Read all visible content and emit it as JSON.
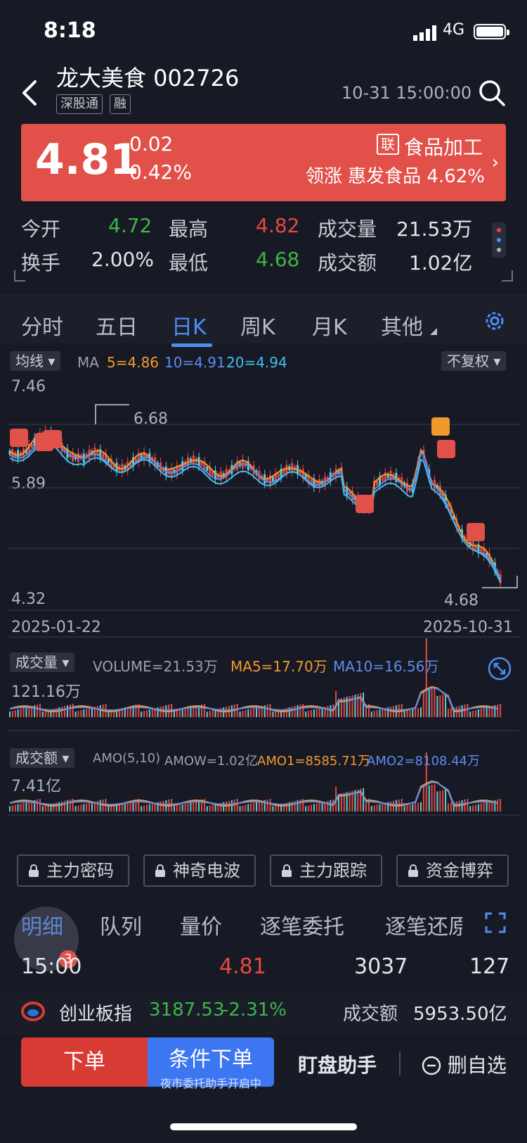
{
  "status_bar": {
    "time": "8:18",
    "network": "4G"
  },
  "header": {
    "stock_name": "龙大美食 002726",
    "tags": [
      "深股通",
      "融"
    ],
    "datetime": "10-31 15:00:00"
  },
  "quote": {
    "price": "4.81",
    "change": "0.02",
    "change_pct": "0.42%",
    "sector_tag": "联",
    "sector": "食品加工",
    "leader": "领涨 惠发食品 4.62%"
  },
  "stats": {
    "open_label": "今开",
    "open": "4.72",
    "high_label": "最高",
    "high": "4.82",
    "vol_label": "成交量",
    "vol": "21.53万",
    "turnover_label": "换手",
    "turnover": "2.00%",
    "low_label": "最低",
    "low": "4.68",
    "amount_label": "成交额",
    "amount": "1.02亿"
  },
  "tabs": [
    "分时",
    "五日",
    "日K",
    "周K",
    "月K",
    "其他"
  ],
  "kline": {
    "ma_dropdown": "均线",
    "ma_label": "MA",
    "ma5": "5=4.86",
    "ma10": "10=4.91",
    "ma20": "20=4.94",
    "adjust_dropdown": "不复权",
    "y_top": "7.46",
    "y_mid": "5.89",
    "y_bottom": "4.32",
    "max_marker": "6.68",
    "min_marker": "4.68",
    "date_start": "2025-01-22",
    "date_end": "2025-10-31",
    "markers": [
      "建",
      "买",
      "买",
      "T",
      "买",
      "买",
      "买"
    ]
  },
  "volume_panel": {
    "dropdown": "成交量",
    "volume": "VOLUME=21.53万",
    "ma5": "MA5=17.70万",
    "ma10": "MA10=16.56万",
    "max": "121.16万"
  },
  "amount_panel": {
    "dropdown": "成交额",
    "amo": "AMO(5,10)",
    "amow": "AMOW=1.02亿",
    "amo1": "AMO1=8585.71万",
    "amo2": "AMO2=8108.44万",
    "max": "7.41亿"
  },
  "premium_buttons": [
    "主力密码",
    "神奇电波",
    "主力跟踪",
    "资金博弈"
  ],
  "bottom_tabs": [
    "明细",
    "队列",
    "量价",
    "逐笔委托",
    "逐笔还原"
  ],
  "badge_count": "3",
  "trade_row": {
    "time": "15:00",
    "price": "4.81",
    "volume": "3037",
    "count": "127"
  },
  "index_bar": {
    "name": "创业板指",
    "value": "3187.53",
    "change": "-2.31%",
    "amount_label": "成交额",
    "amount": "5953.50亿"
  },
  "actions": {
    "order": "下单",
    "conditional": "条件下单",
    "conditional_sub": "夜市委托助手开启中",
    "helper": "盯盘助手",
    "unwatch": "删自选"
  },
  "colors": {
    "up": "#e8483f",
    "down": "#3db54a",
    "ma5": "#f2992e",
    "ma10": "#5b8cf0",
    "ma20": "#3fbff0",
    "accent": "#4d8df7",
    "banner": "#e2504a"
  }
}
